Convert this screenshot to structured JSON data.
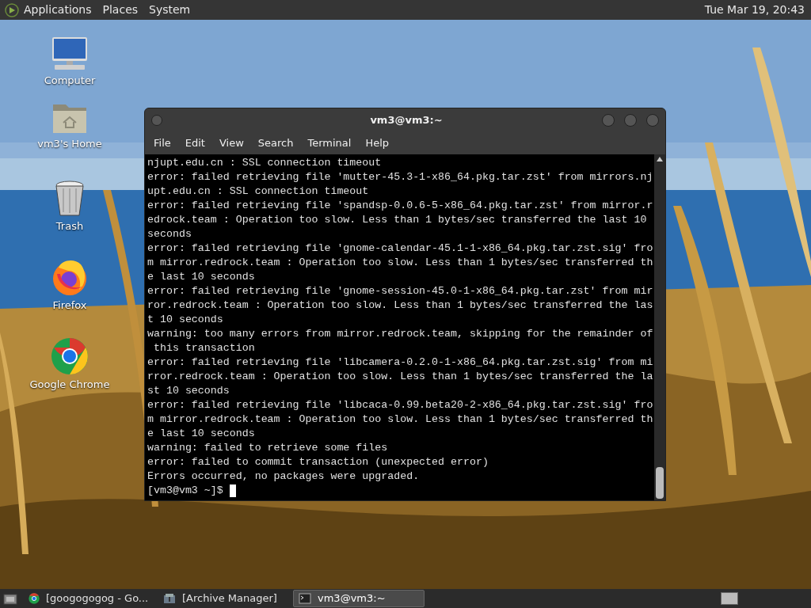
{
  "top_panel": {
    "menus": [
      "Applications",
      "Places",
      "System"
    ],
    "clock": "Tue Mar 19, 20:43"
  },
  "desktop_icons": [
    {
      "kind": "computer",
      "label": "Computer"
    },
    {
      "kind": "home",
      "label": "vm3's Home"
    },
    {
      "kind": "trash",
      "label": "Trash"
    },
    {
      "kind": "firefox",
      "label": "Firefox"
    },
    {
      "kind": "chrome",
      "label": "Google Chrome"
    }
  ],
  "terminal": {
    "title": "vm3@vm3:~",
    "menus": [
      "File",
      "Edit",
      "View",
      "Search",
      "Terminal",
      "Help"
    ],
    "lines": [
      "njupt.edu.cn : SSL connection timeout",
      "error: failed retrieving file 'mutter-45.3-1-x86_64.pkg.tar.zst' from mirrors.nj",
      "upt.edu.cn : SSL connection timeout",
      "error: failed retrieving file 'spandsp-0.0.6-5-x86_64.pkg.tar.zst' from mirror.r",
      "edrock.team : Operation too slow. Less than 1 bytes/sec transferred the last 10",
      "seconds",
      "error: failed retrieving file 'gnome-calendar-45.1-1-x86_64.pkg.tar.zst.sig' fro",
      "m mirror.redrock.team : Operation too slow. Less than 1 bytes/sec transferred th",
      "e last 10 seconds",
      "error: failed retrieving file 'gnome-session-45.0-1-x86_64.pkg.tar.zst' from mir",
      "ror.redrock.team : Operation too slow. Less than 1 bytes/sec transferred the las",
      "t 10 seconds",
      "warning: too many errors from mirror.redrock.team, skipping for the remainder of",
      " this transaction",
      "error: failed retrieving file 'libcamera-0.2.0-1-x86_64.pkg.tar.zst.sig' from mi",
      "rror.redrock.team : Operation too slow. Less than 1 bytes/sec transferred the la",
      "st 10 seconds",
      "error: failed retrieving file 'libcaca-0.99.beta20-2-x86_64.pkg.tar.zst.sig' fro",
      "m mirror.redrock.team : Operation too slow. Less than 1 bytes/sec transferred th",
      "e last 10 seconds",
      "warning: failed to retrieve some files",
      "error: failed to commit transaction (unexpected error)",
      "Errors occurred, no packages were upgraded."
    ],
    "prompt": "[vm3@vm3 ~]$"
  },
  "taskbar": [
    {
      "kind": "chrome",
      "label": "[googogogog - Go...",
      "selected": false
    },
    {
      "kind": "archive",
      "label": "[Archive Manager]",
      "selected": false
    },
    {
      "kind": "terminal",
      "label": "vm3@vm3:~",
      "selected": true
    }
  ]
}
